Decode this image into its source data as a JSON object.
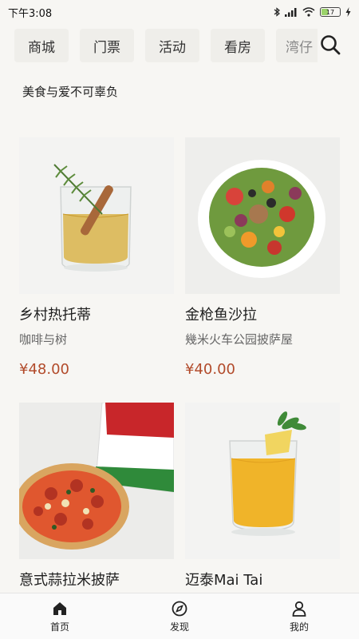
{
  "status_bar": {
    "time": "下午3:08",
    "battery": "17",
    "icons": [
      "bluetooth-icon",
      "signal-icon",
      "wifi-icon",
      "battery-icon",
      "charging-icon"
    ]
  },
  "tabs": [
    {
      "label": "商城"
    },
    {
      "label": "门票"
    },
    {
      "label": "活动"
    },
    {
      "label": "看房"
    },
    {
      "label": "湾仔"
    }
  ],
  "section": {
    "title": "美食与爱不可辜负"
  },
  "products": [
    {
      "name": "乡村热托蒂",
      "shop": "咖啡与树",
      "price": "¥48.00",
      "image": "whiskey-glass-drink"
    },
    {
      "name": "金枪鱼沙拉",
      "shop": "幾米火车公园披萨屋",
      "price": "¥40.00",
      "image": "tuna-salad-bowl"
    },
    {
      "name": "意式蒜拉米披萨",
      "shop": "",
      "price": "",
      "image": "pizza-and-box"
    },
    {
      "name": "迈泰Mai Tai",
      "shop": "",
      "price": "",
      "image": "yellow-cocktail-glass"
    }
  ],
  "bottom_nav": [
    {
      "label": "首页",
      "icon": "home-icon",
      "active": true
    },
    {
      "label": "发现",
      "icon": "compass-icon",
      "active": false
    },
    {
      "label": "我的",
      "icon": "user-icon",
      "active": false
    }
  ],
  "colors": {
    "background": "#f7f6f3",
    "tab_bg": "#efeeea",
    "price": "#b24b2b",
    "battery_fill": "#9bd36a"
  }
}
